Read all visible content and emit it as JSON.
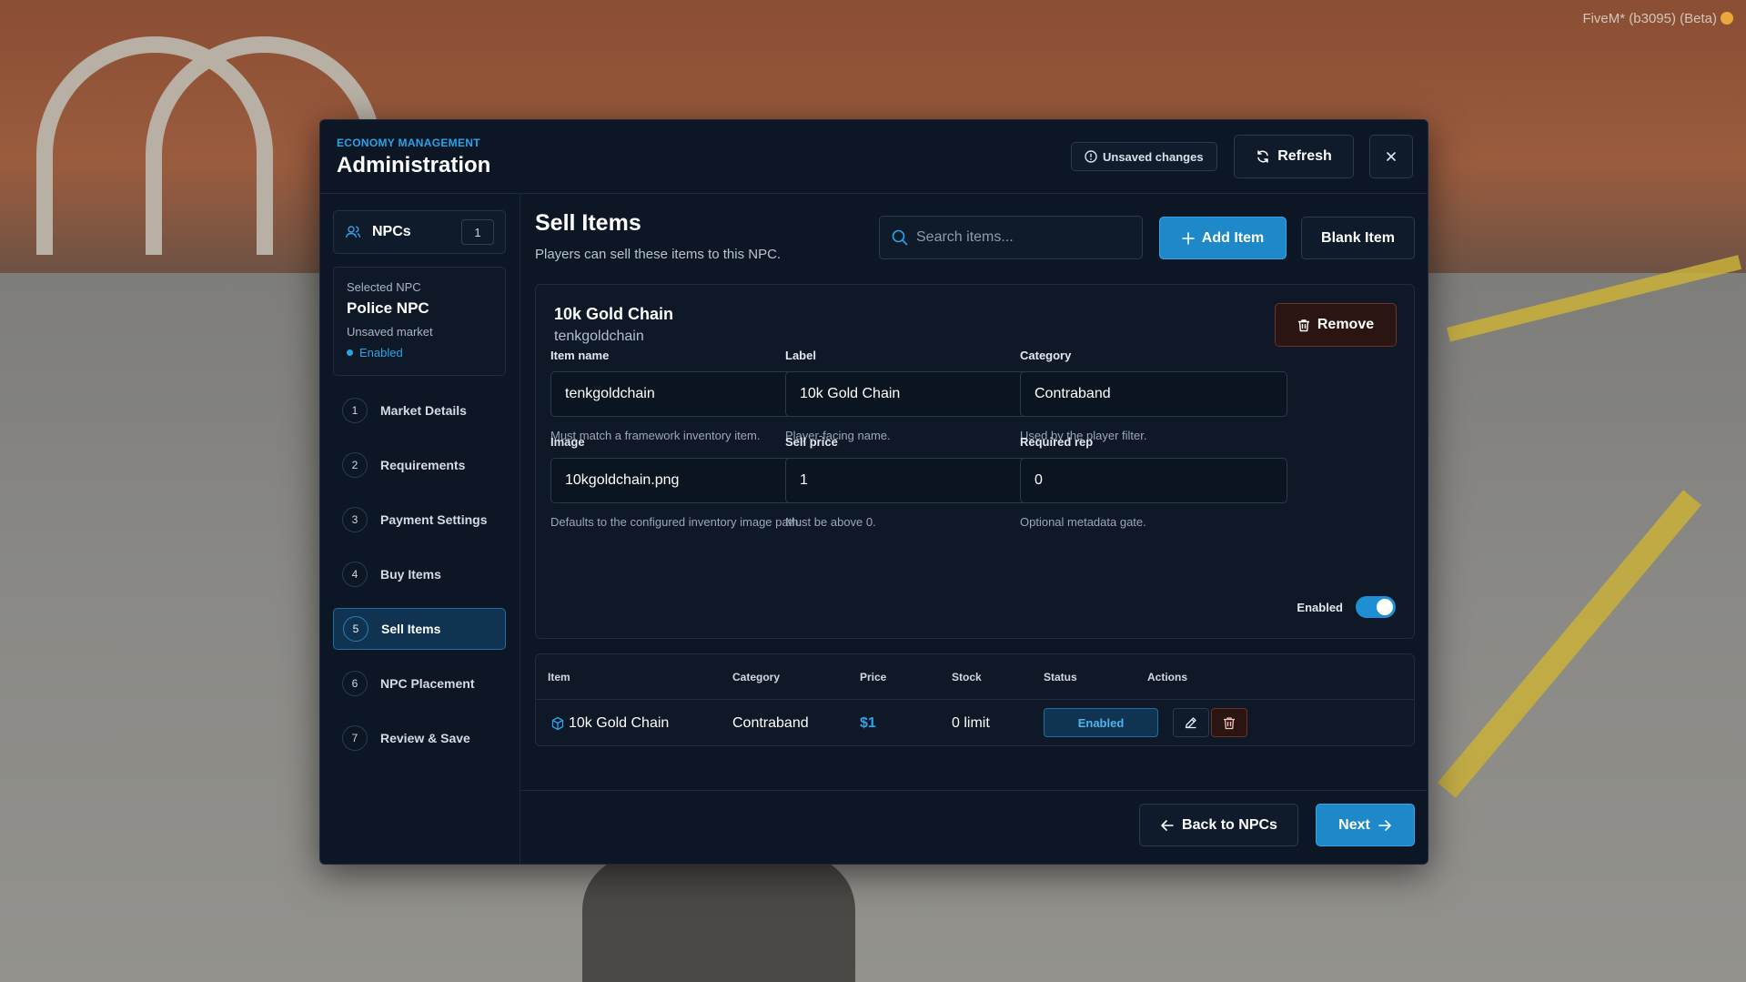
{
  "overlay": {
    "client_label": "FiveM* (b3095) (Beta)"
  },
  "header": {
    "eyebrow": "ECONOMY MANAGEMENT",
    "title": "Administration",
    "unsaved_label": "Unsaved changes",
    "refresh_label": "Refresh"
  },
  "sidebar": {
    "npcs_label": "NPCs",
    "npcs_count": "1",
    "selected_caption": "Selected NPC",
    "selected_name": "Police NPC",
    "selected_market": "Unsaved market",
    "selected_status": "Enabled",
    "steps": [
      {
        "num": "1",
        "label": "Market Details"
      },
      {
        "num": "2",
        "label": "Requirements"
      },
      {
        "num": "3",
        "label": "Payment Settings"
      },
      {
        "num": "4",
        "label": "Buy Items"
      },
      {
        "num": "5",
        "label": "Sell Items"
      },
      {
        "num": "6",
        "label": "NPC Placement"
      },
      {
        "num": "7",
        "label": "Review & Save"
      }
    ],
    "active_step": "5"
  },
  "main": {
    "title": "Sell Items",
    "subtitle": "Players can sell these items to this NPC.",
    "search_placeholder": "Search items...",
    "add_label": "Add Item",
    "blank_label": "Blank Item"
  },
  "editor": {
    "item_title": "10k Gold Chain",
    "item_key": "tenkgoldchain",
    "remove_label": "Remove",
    "fields": {
      "item_name": {
        "label": "Item name",
        "value": "tenkgoldchain",
        "hint": "Must match a framework inventory item."
      },
      "label": {
        "label": "Label",
        "value": "10k Gold Chain",
        "hint": "Player-facing name."
      },
      "category": {
        "label": "Category",
        "value": "Contraband",
        "hint": "Used by the player filter."
      },
      "image": {
        "label": "Image",
        "value": "10kgoldchain.png",
        "hint": "Defaults to the configured inventory image path."
      },
      "sell_price": {
        "label": "Sell price",
        "value": "1",
        "hint": "Must be above 0."
      },
      "required_rep": {
        "label": "Required rep",
        "value": "0",
        "hint": "Optional metadata gate."
      }
    },
    "enabled_label": "Enabled",
    "enabled": true
  },
  "table": {
    "headers": [
      "Item",
      "Category",
      "Price",
      "Stock",
      "Status",
      "Actions"
    ],
    "rows": [
      {
        "item": "10k Gold Chain",
        "category": "Contraband",
        "price": "$1",
        "stock": "0 limit",
        "status": "Enabled"
      }
    ]
  },
  "footer": {
    "back_label": "Back to NPCs",
    "next_label": "Next"
  },
  "colors": {
    "accent": "#1e88c8",
    "accent_text": "#2aa3e8",
    "panel": "#0c1624",
    "danger": "#6a3326"
  },
  "icons": {
    "unsaved": "info-circle-icon",
    "refresh": "refresh-icon",
    "close": "close-icon",
    "npcs": "users-icon",
    "search": "search-icon",
    "add": "plus-icon",
    "remove": "trash-icon",
    "item": "cube-icon",
    "edit": "pencil-icon",
    "delete": "trash-icon",
    "back": "arrow-left-icon",
    "next": "arrow-right-icon"
  }
}
